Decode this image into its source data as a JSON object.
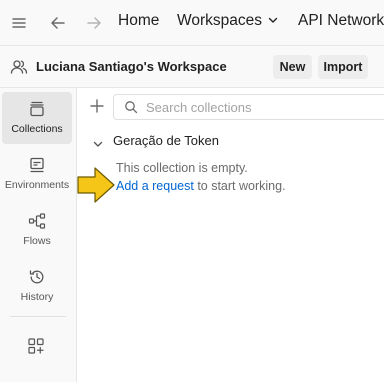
{
  "topbar": {
    "menu_icon": "hamburger-icon",
    "back_icon": "arrow-left-icon",
    "forward_icon": "arrow-right-icon",
    "home": "Home",
    "workspaces": "Workspaces",
    "api_network": "API Network"
  },
  "workspace": {
    "icon": "people-icon",
    "title": "Luciana Santiago's Workspace",
    "new_label": "New",
    "import_label": "Import"
  },
  "sidebar": {
    "items": [
      {
        "label": "Collections",
        "icon": "collections-icon",
        "active": true
      },
      {
        "label": "Environments",
        "icon": "environments-icon",
        "active": false
      },
      {
        "label": "Flows",
        "icon": "flows-icon",
        "active": false
      },
      {
        "label": "History",
        "icon": "history-icon",
        "active": false
      }
    ],
    "configure_icon": "configure-workbench-icon"
  },
  "collections": {
    "search_placeholder": "Search collections",
    "collection_name": "Geração de Token",
    "empty_message": "This collection is empty.",
    "add_request_link": "Add a request",
    "add_request_suffix": " to start working."
  },
  "annotation": {
    "arrow_color": "#f5c518",
    "arrow_outline": "#6b5a00"
  },
  "colors": {
    "accent_link": "#0265d2",
    "active_item_bg": "#e6e6e6"
  }
}
